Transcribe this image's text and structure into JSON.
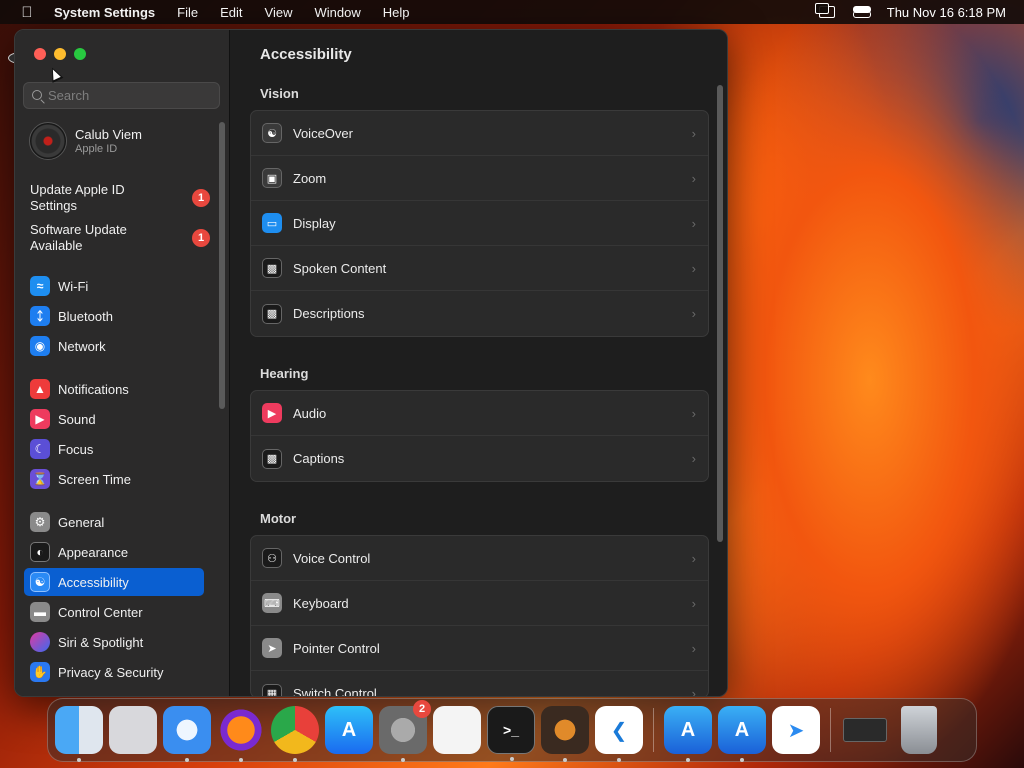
{
  "menubar": {
    "apple": "",
    "app": "System Settings",
    "menus": [
      "File",
      "Edit",
      "View",
      "Window",
      "Help"
    ],
    "clock": "Thu Nov 16  6:18 PM"
  },
  "sidebar": {
    "search_placeholder": "Search",
    "profile": {
      "name": "Calub Viem",
      "sub": "Apple ID"
    },
    "notices": [
      {
        "text": "Update Apple ID Settings",
        "badge": "1"
      },
      {
        "text": "Software Update Available",
        "badge": "1"
      }
    ],
    "items": [
      {
        "label": "Wi-Fi",
        "icon": "wifi-icon",
        "color": "#1e8ef0"
      },
      {
        "label": "Bluetooth",
        "icon": "bluetooth-icon",
        "color": "#1e7ef0"
      },
      {
        "label": "Network",
        "icon": "globe-icon",
        "color": "#1e7ef0"
      },
      {
        "label": "Notifications",
        "icon": "bell-icon",
        "color": "#ee3b3b"
      },
      {
        "label": "Sound",
        "icon": "speaker-icon",
        "color": "#ee3b5e"
      },
      {
        "label": "Focus",
        "icon": "moon-icon",
        "color": "#5b4fd6"
      },
      {
        "label": "Screen Time",
        "icon": "hourglass-icon",
        "color": "#6a4fd6"
      },
      {
        "label": "General",
        "icon": "gear-icon",
        "color": "#8a8a8a"
      },
      {
        "label": "Appearance",
        "icon": "appearance-icon",
        "color": "#1a1a1a"
      },
      {
        "label": "Accessibility",
        "icon": "accessibility-icon",
        "color": "#1e7ef0"
      },
      {
        "label": "Control Center",
        "icon": "switches-icon",
        "color": "#8a8a8a"
      },
      {
        "label": "Siri & Spotlight",
        "icon": "siri-icon",
        "color": "#b03ad0"
      },
      {
        "label": "Privacy & Security",
        "icon": "hand-icon",
        "color": "#2a78f0"
      }
    ]
  },
  "main": {
    "title": "Accessibility",
    "sections": [
      {
        "heading": "Vision",
        "rows": [
          {
            "label": "VoiceOver",
            "icon": "voiceover-icon"
          },
          {
            "label": "Zoom",
            "icon": "zoom-icon"
          },
          {
            "label": "Display",
            "icon": "display-icon"
          },
          {
            "label": "Spoken Content",
            "icon": "spoken-content-icon"
          },
          {
            "label": "Descriptions",
            "icon": "descriptions-icon"
          }
        ]
      },
      {
        "heading": "Hearing",
        "rows": [
          {
            "label": "Audio",
            "icon": "audio-icon"
          },
          {
            "label": "Captions",
            "icon": "captions-icon"
          }
        ]
      },
      {
        "heading": "Motor",
        "rows": [
          {
            "label": "Voice Control",
            "icon": "voice-control-icon"
          },
          {
            "label": "Keyboard",
            "icon": "keyboard-icon"
          },
          {
            "label": "Pointer Control",
            "icon": "pointer-icon"
          },
          {
            "label": "Switch Control",
            "icon": "switch-control-icon"
          }
        ]
      }
    ]
  },
  "dock": {
    "settings_badge": "2"
  }
}
